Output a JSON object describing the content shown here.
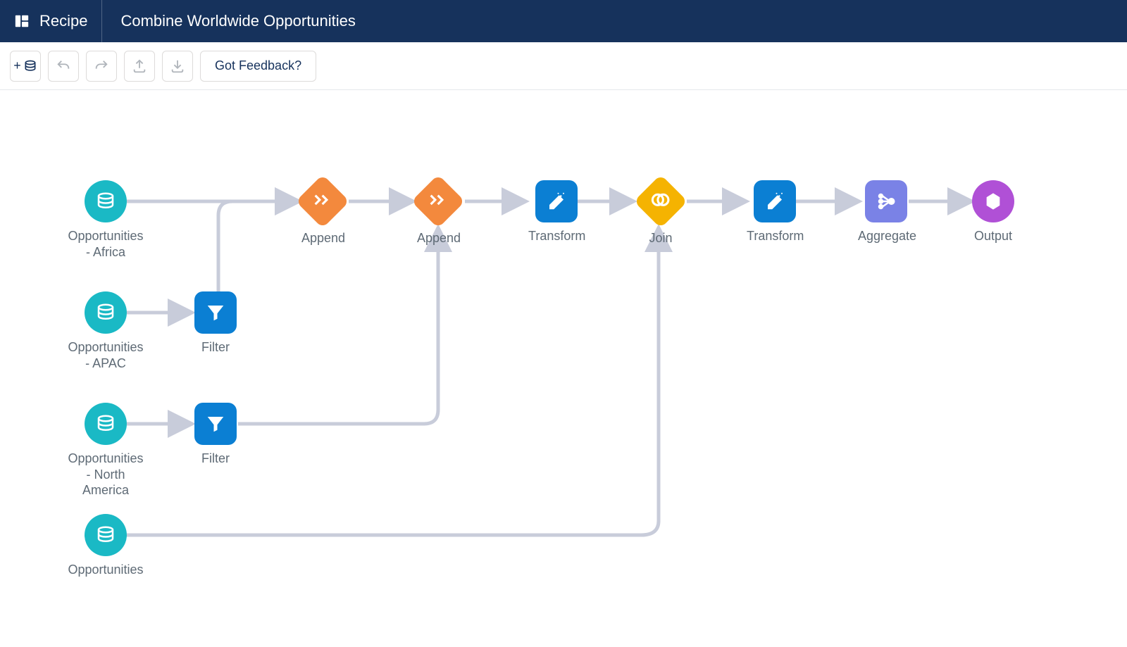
{
  "header": {
    "section_label": "Recipe",
    "title": "Combine Worldwide Opportunities"
  },
  "toolbar": {
    "add_label": "+",
    "feedback_label": "Got Feedback?"
  },
  "nodes": {
    "src_africa": "Opportunities\n- Africa",
    "src_apac": "Opportunities\n- APAC",
    "src_na": "Opportunities\n- North\nAmerica",
    "src_opp": "Opportunities",
    "filter1": "Filter",
    "filter2": "Filter",
    "append1": "Append",
    "append2": "Append",
    "transform1": "Transform",
    "join": "Join",
    "transform2": "Transform",
    "aggregate": "Aggregate",
    "output": "Output"
  }
}
